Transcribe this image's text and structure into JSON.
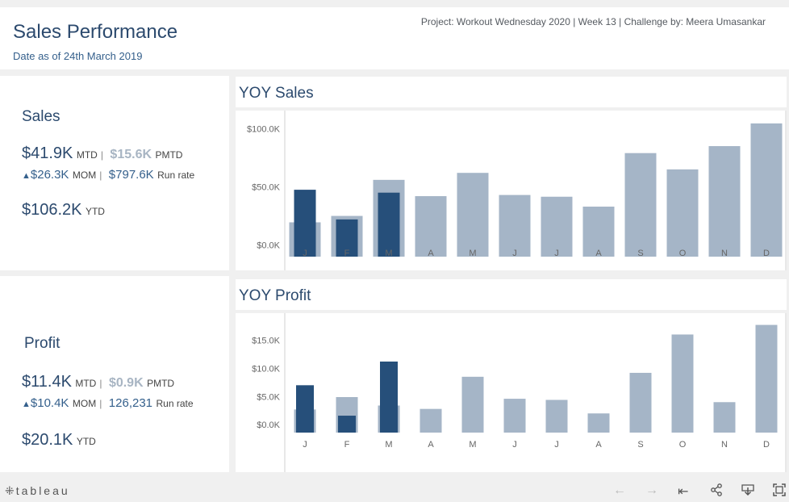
{
  "header": {
    "title": "Sales Performance",
    "subtitle": "Date as of 24th March 2019",
    "credits": "Project: Workout Wednesday 2020 | Week 13 | Challenge by: Meera Umasankar"
  },
  "sales_kpi": {
    "heading": "Sales",
    "mtd_value": "$41.9K",
    "mtd_label": "MTD",
    "pmtd_value": "$15.6K",
    "pmtd_label": "PMTD",
    "mom_arrow": "▲",
    "mom_value": "$26.3K",
    "mom_label": "MOM",
    "runrate_value": "$797.6K",
    "runrate_label": "Run rate",
    "ytd_value": "$106.2K",
    "ytd_label": "YTD"
  },
  "profit_kpi": {
    "heading": "Profit",
    "mtd_value": "$11.4K",
    "mtd_label": "MTD",
    "pmtd_value": "$0.9K",
    "pmtd_label": "PMTD",
    "mom_arrow": "▲",
    "mom_value": "$10.4K",
    "mom_label": "MOM",
    "runrate_value": "126,231",
    "runrate_label": "Run rate",
    "ytd_value": "$20.1K",
    "ytd_label": "YTD"
  },
  "colors": {
    "prior_year": "#a5b5c7",
    "current_year": "#264f7a",
    "title": "#2c4a6e"
  },
  "footer": {
    "brand_mark": "⁜",
    "brand": "tableau",
    "icons": [
      "undo-icon",
      "redo-icon",
      "revert-icon",
      "share-icon",
      "download-icon",
      "fullscreen-icon"
    ]
  },
  "chart_data": [
    {
      "type": "bar",
      "title": "YOY Sales",
      "categories": [
        "J",
        "F",
        "M",
        "A",
        "M",
        "J",
        "J",
        "A",
        "S",
        "O",
        "N",
        "D"
      ],
      "yticks": [
        "$0.0K",
        "$50.0K",
        "$100.0K"
      ],
      "ytick_values": [
        0,
        50,
        100
      ],
      "ylim": [
        -10,
        110
      ],
      "series": [
        {
          "role": "prior",
          "values": [
            19.5,
            25,
            56,
            42,
            62,
            43,
            41.5,
            33,
            79,
            65,
            85,
            104.5
          ]
        },
        {
          "role": "current",
          "values": [
            47.5,
            22,
            45,
            null,
            null,
            null,
            null,
            null,
            null,
            null,
            null,
            null
          ]
        }
      ]
    },
    {
      "type": "bar",
      "title": "YOY Profit",
      "categories": [
        "J",
        "F",
        "M",
        "A",
        "M",
        "J",
        "J",
        "A",
        "S",
        "O",
        "N",
        "D"
      ],
      "yticks": [
        "$0.0K",
        "$5.0K",
        "$10.0K",
        "$15.0K"
      ],
      "ytick_values": [
        0,
        5,
        10,
        15
      ],
      "ylim": [
        -1.4,
        19.5
      ],
      "series": [
        {
          "role": "prior",
          "values": [
            2.7,
            4.9,
            3.4,
            2.8,
            8.5,
            4.6,
            4.4,
            2.0,
            9.2,
            16.0,
            4.0,
            17.7
          ]
        },
        {
          "role": "current",
          "values": [
            7.0,
            1.6,
            11.2,
            null,
            null,
            null,
            null,
            null,
            null,
            null,
            null,
            null
          ]
        }
      ]
    }
  ]
}
